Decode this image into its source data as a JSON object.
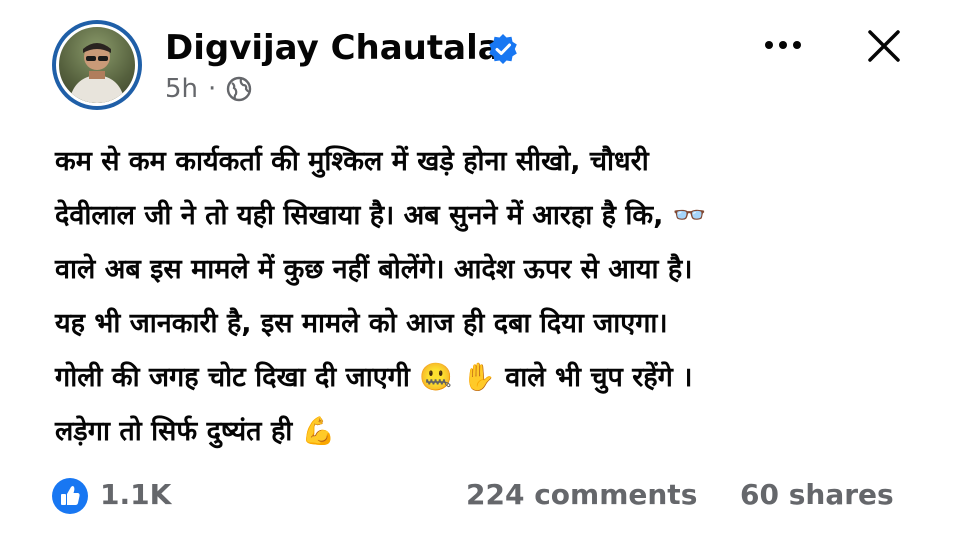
{
  "post": {
    "author": "Digvijay Chautala",
    "time": "5h",
    "separator": "·",
    "visibility_icon": "globe-icon",
    "verified_icon": "verified-badge-icon",
    "text": "कम से कम कार्यकर्ता की मुश्किल में खड़े होना सीखो, चौधरी\nदेवीलाल जी ने तो यही सिखाया है। अब सुनने में आरहा है कि, 👓\nवाले अब इस मामले में कुछ नहीं बोलेंगे। आदेश ऊपर से आया है।\nयह भी जानकारी है, इस मामले को आज ही दबा दिया जाएगा।\nगोली की जगह चोट दिखा दी जाएगी 🤐 ✋ वाले भी चुप रहेंगे ।\nलड़ेगा तो सिर्फ दुष्यंत ही 💪"
  },
  "reactions": {
    "likes": "1.1K",
    "comments": "224 comments",
    "shares": "60 shares",
    "like_icon": "like-thumb-icon"
  },
  "colors": {
    "accent": "#1877f2",
    "secondary_text": "#65676b",
    "primary_text": "#050505"
  }
}
